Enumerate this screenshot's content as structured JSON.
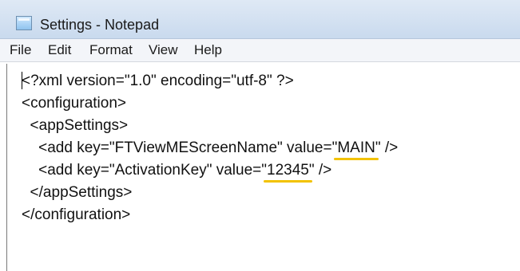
{
  "window": {
    "title": "Settings - Notepad",
    "icon": "notepad-icon"
  },
  "menu": [
    "File",
    "Edit",
    "Format",
    "View",
    "Help"
  ],
  "document": {
    "line1": "<?xml version=\"1.0\" encoding=\"utf-8\" ?>",
    "line2": "<configuration>",
    "line3": "  <appSettings>",
    "line4": {
      "before": "    <add key=\"FTViewMEScreenName\" value=\"",
      "value": "MAIN",
      "after": "\" />"
    },
    "line5": {
      "before": "    <add key=\"ActivationKey\" value=\"",
      "value": "12345",
      "after": "\" />"
    },
    "line6": "  </appSettings>",
    "line7": "</configuration>"
  },
  "highlight_color": "#f2c200"
}
